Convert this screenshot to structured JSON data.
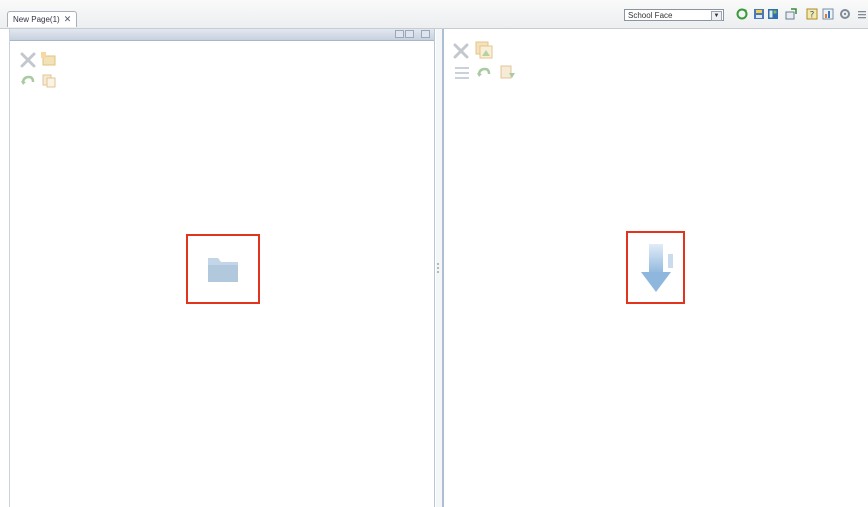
{
  "tab": {
    "label": "New Page(1)",
    "close_glyph": "✕"
  },
  "toolbar": {
    "view_select": {
      "value": "School Face"
    },
    "icons": [
      "refresh-icon",
      "save-icon",
      "layout-icon",
      "export-icon",
      "help-icon",
      "chart-icon",
      "settings-icon",
      "options-icon"
    ]
  },
  "left_pane": {
    "toolbar_icons": [
      "delete-icon",
      "new-folder-icon",
      "undo-icon",
      "copy-icon"
    ],
    "center_icon": "folder-icon"
  },
  "right_pane": {
    "toolbar_icons": [
      "delete-icon",
      "image-icon",
      "align-icon",
      "undo-icon",
      "paste-icon"
    ],
    "center_icon": "down-arrow-icon"
  },
  "colors": {
    "highlight": "#e2341d",
    "pane_border": "#aebfd4",
    "icon_muted": "#c6d2df"
  }
}
